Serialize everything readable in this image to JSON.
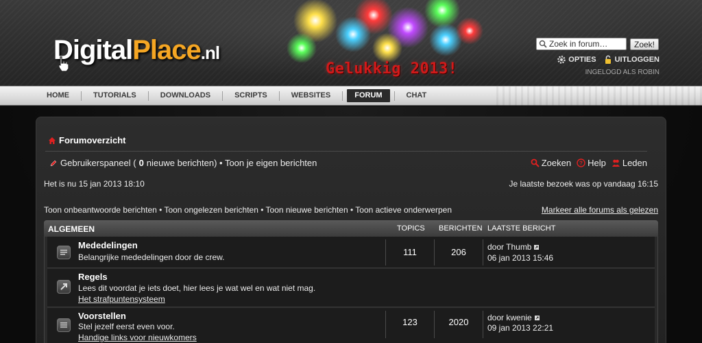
{
  "header": {
    "logo": {
      "part1": "Digital",
      "part2": "Place",
      "part3": ".nl"
    },
    "greeting": "Gelukkig 2013!",
    "search": {
      "placeholder": "Zoek in forum…",
      "button": "Zoek!"
    },
    "links": {
      "options": "Opties",
      "logout": "Uitloggen"
    },
    "login_status": "Ingelogd als Robin"
  },
  "nav": {
    "items": [
      "Home",
      "Tutorials",
      "Downloads",
      "Scripts",
      "Websites",
      "Forum",
      "Chat"
    ],
    "active": "Forum"
  },
  "breadcrumb": "Forumoverzicht",
  "ucp": {
    "prefix": "Gebruikerspaneel (",
    "count": "0",
    "suffix": " nieuwe berichten) • Toon je eigen berichten"
  },
  "tools": {
    "search": "Zoeken",
    "help": "Help",
    "members": "Leden"
  },
  "date_now": "Het is nu 15 jan 2013 18:10",
  "last_visit": "Je laatste bezoek was op vandaag 16:15",
  "quick_links": "Toon onbeantwoorde berichten • Toon ongelezen berichten • Toon nieuwe berichten • Toon actieve onderwerpen",
  "mark_read": "Markeer alle forums als gelezen",
  "forum": {
    "category": "Algemeen",
    "col_topics": "Topics",
    "col_posts": "Berichten",
    "col_last": "Laatste bericht",
    "rows": [
      {
        "title": "Mededelingen",
        "desc": "Belangrijke mededelingen door de crew.",
        "sub": "",
        "topics": "111",
        "posts": "206",
        "last_by": "door Thumb",
        "last_date": "06 jan 2013 15:46"
      },
      {
        "title": "Regels",
        "desc": "Lees dit voordat je iets doet, hier lees je wat wel en wat niet mag.",
        "sub": "Het strafpuntensysteem",
        "topics": "",
        "posts": "",
        "last_by": "",
        "last_date": ""
      },
      {
        "title": "Voorstellen",
        "desc": "Stel jezelf eerst even voor.",
        "sub": "Handige links voor nieuwkomers",
        "topics": "123",
        "posts": "2020",
        "last_by": "door kwenie",
        "last_date": "09 jan 2013 22:21"
      }
    ]
  },
  "colors": {
    "accent_orange": "#f5a623",
    "greeting_red": "#d11a1a",
    "icon_red": "#e02020"
  }
}
